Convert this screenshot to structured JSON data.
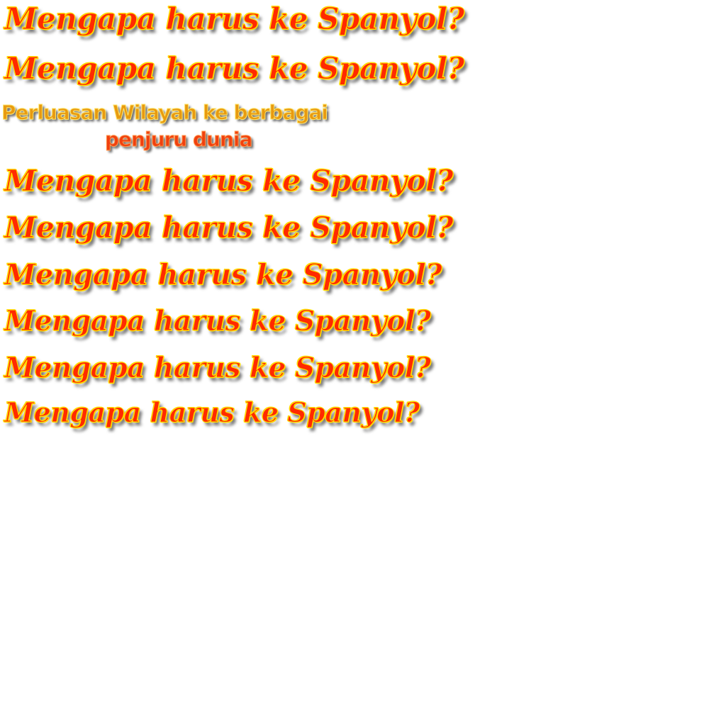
{
  "headlines": [
    "Mengapa harus ke Spanyol?",
    "Mengapa harus ke Spanyol?",
    "Mengapa harus ke Spanyol?",
    "Mengapa harus ke Spanyol?",
    "Mengapa harus ke Spanyol?",
    "Mengapa harus ke Spanyol?",
    "Mengapa harus ke Spanyol?",
    "Mengapa harus ke Spanyol?"
  ],
  "subtitle": {
    "line1": "Perluasan Wilayah ke berbagai",
    "line2": "penjuru dunia"
  },
  "colors": {
    "headline_fill": "#ff2a00",
    "headline_outline": "#ffe400",
    "subtitle_line1": "#e89a10",
    "subtitle_line2": "#f0400f",
    "background": "#ffffff"
  }
}
